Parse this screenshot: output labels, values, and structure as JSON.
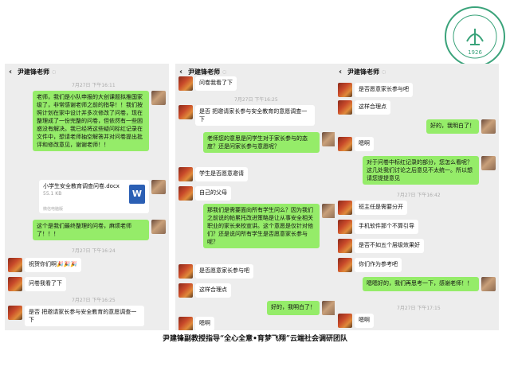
{
  "seal": {
    "text": "1926"
  },
  "panels": [
    {
      "title": "尹建锋老师",
      "items": [
        {
          "ts": "7月27日 下午16:11"
        },
        {
          "text": "老师，我们是小队申报的大创课题拟推国家级了，非常感谢老师之前的指导！！我们按照计划在家中设计并多次修改了问卷，现在整理成了一份完整的问卷，但依然有一些困惑没有解决。我已经将这些疑问标红记录在文件中，想请老师抽空解答并对问卷提出批评和修改意见，谢谢老师！！"
        },
        {
          "file_name": "小学生安全教育调查问卷.docx",
          "file_size": "55.1 KB",
          "file_src": "微信电脑版",
          "file_icon": "W"
        },
        {
          "text": "这个是我们最终整理的问卷，麻烦老师了！！！"
        },
        {
          "ts": "7月27日 下午16:24"
        },
        {
          "text": "祝贺你们啊🎉🎉🎉"
        },
        {
          "text": "问卷我看了下"
        },
        {
          "ts": "7月27日 下午16:25"
        },
        {
          "text": "是否 把邀请家长参与安全教育的意愿调查一下"
        }
      ]
    },
    {
      "title": "尹建锋老师",
      "items": [
        {
          "text": "问卷我看了下"
        },
        {
          "ts": "7月27日 下午16:25"
        },
        {
          "text": "是否 把邀请家长参与安全教育的意愿调查一下"
        },
        {
          "text": "老师您的意思是问学生对于家长参与的态度？还是问家长参与意愿呢？"
        },
        {
          "text": "学生是否愿意邀请"
        },
        {
          "text": "自己的父母"
        },
        {
          "text": "那我们是需要面向所有学生问么？因为我们之前说的帕累托改进策略是让从事安全相关职业的家长来校宣讲。这个意愿是仅针对他们？还是说问所有学生是否愿意家长参与呢？"
        },
        {
          "text": "是否愿意家长参与吧"
        },
        {
          "text": "这样合理点"
        },
        {
          "text": "好的，我明白了！"
        },
        {
          "text": "嗯啊"
        }
      ]
    },
    {
      "title": "尹建锋老师",
      "items": [
        {
          "text": "是否愿意家长参与吧"
        },
        {
          "text": "这样合理点"
        },
        {
          "text": "好的，我明白了！"
        },
        {
          "text": "嗯啊"
        },
        {
          "text": "对于问卷中标红记录的部分，您怎么看呢？这几处我们讨论之后意见不太统一。所以想请您提提意见"
        },
        {
          "ts": "7月27日 下午16:42"
        },
        {
          "text": "班主任是需要分开"
        },
        {
          "text": "手机软件那个不算引导"
        },
        {
          "text": "是否不如五个层级效果好"
        },
        {
          "text": "你们作为参考吧"
        },
        {
          "text": "嗯嗯好的，我们再思考一下，感谢老师！！"
        },
        {
          "ts": "7月27日 下午17:15"
        },
        {
          "text": "嗯啊"
        }
      ]
    }
  ],
  "caption": "尹建锋副教授指导“全心全意•育梦飞翔”云端社会调研团队"
}
